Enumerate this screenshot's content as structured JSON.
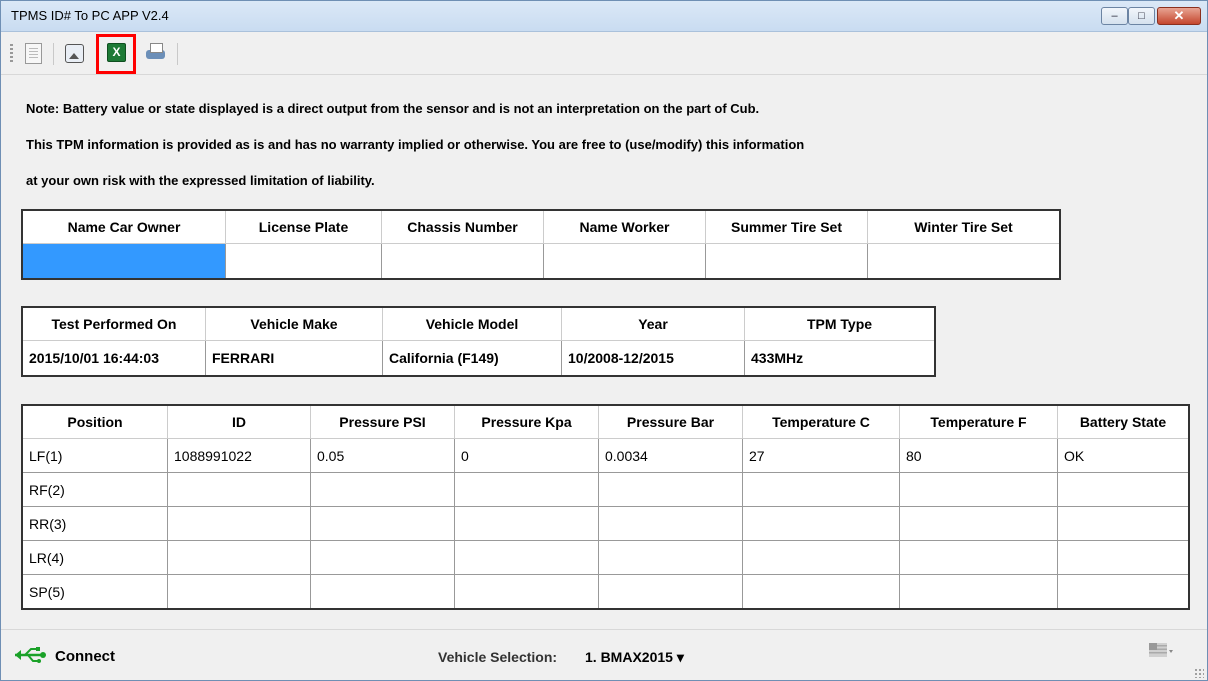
{
  "window": {
    "title": "TPMS ID# To PC APP V2.4",
    "min": "–",
    "max": "□",
    "close": "✕"
  },
  "toolbar": {
    "icons": [
      "document-icon",
      "image-icon",
      "excel-icon",
      "printer-icon"
    ],
    "xls_glyph": "X"
  },
  "notes": [
    "Note: Battery value or state displayed is a direct output from the sensor and is not an interpretation on the part of Cub.",
    "This TPM information is provided as is and has no warranty implied or otherwise. You are free to (use/modify) this information",
    "at your own risk with the expressed limitation of liability."
  ],
  "owner_table": {
    "headers": [
      "Name Car Owner",
      "License Plate",
      "Chassis Number",
      "Name Worker",
      "Summer Tire Set",
      "Winter Tire Set"
    ],
    "row": [
      "",
      "",
      "",
      "",
      "",
      ""
    ]
  },
  "test_table": {
    "headers": [
      "Test Performed On",
      "Vehicle Make",
      "Vehicle Model",
      "Year",
      "TPM Type"
    ],
    "row": [
      "2015/10/01  16:44:03",
      "FERRARI",
      "California (F149)",
      "10/2008-12/2015",
      "433MHz"
    ]
  },
  "sensor_table": {
    "headers": [
      "Position",
      "ID",
      "Pressure PSI",
      "Pressure Kpa",
      "Pressure Bar",
      "Temperature C",
      "Temperature F",
      "Battery State"
    ],
    "rows": [
      [
        "LF(1)",
        "1088991022",
        "0.05",
        "0",
        "0.0034",
        "27",
        "80",
        "OK"
      ],
      [
        "RF(2)",
        "",
        "",
        "",
        "",
        "",
        "",
        ""
      ],
      [
        "RR(3)",
        "",
        "",
        "",
        "",
        "",
        "",
        ""
      ],
      [
        "LR(4)",
        "",
        "",
        "",
        "",
        "",
        "",
        ""
      ],
      [
        "SP(5)",
        "",
        "",
        "",
        "",
        "",
        "",
        ""
      ]
    ]
  },
  "status": {
    "connect_label": "Connect",
    "vehicle_selection_label": "Vehicle Selection:",
    "vehicle_selection_value": "1. BMAX2015 ▾",
    "accent": "#3399ff"
  }
}
